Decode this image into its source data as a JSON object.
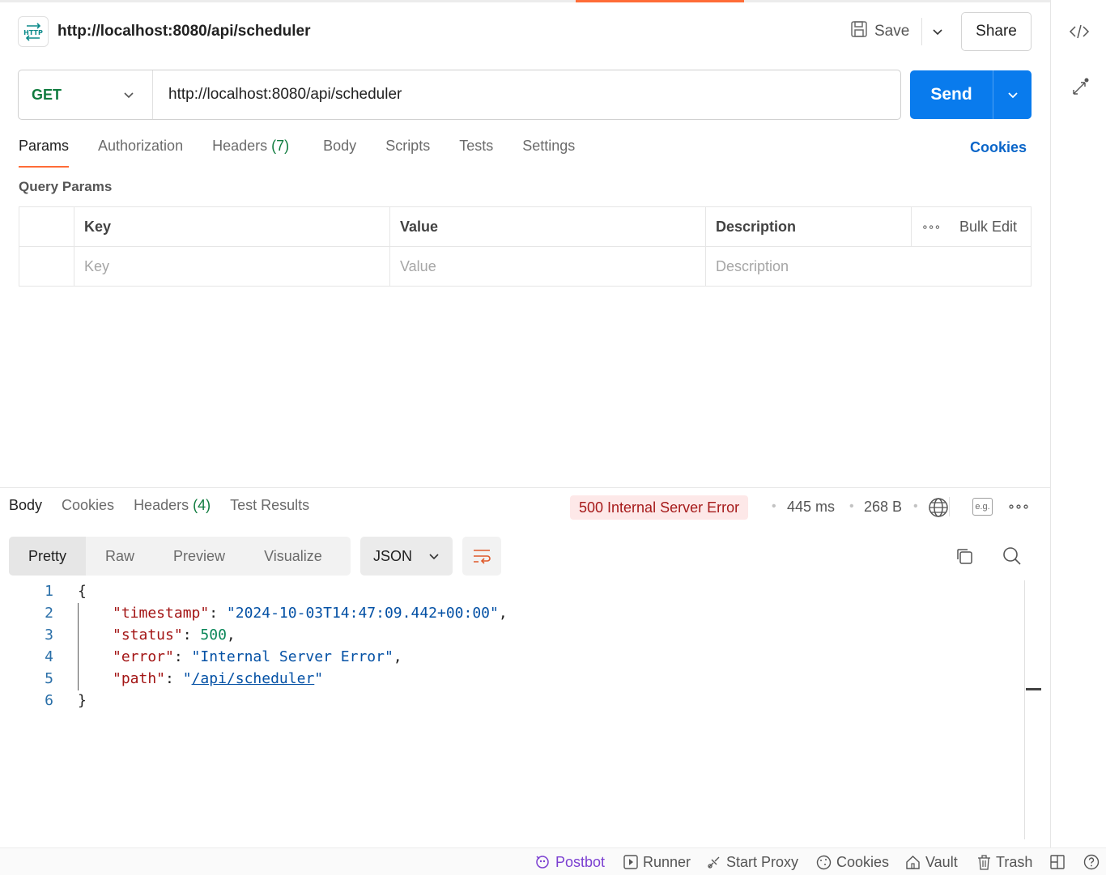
{
  "request": {
    "title": "http://localhost:8080/api/scheduler",
    "method": "GET",
    "url": "http://localhost:8080/api/scheduler",
    "save_label": "Save",
    "share_label": "Share",
    "send_label": "Send"
  },
  "request_tabs": [
    {
      "label": "Params",
      "count": ""
    },
    {
      "label": "Authorization",
      "count": ""
    },
    {
      "label": "Headers",
      "count": "(7)"
    },
    {
      "label": "Body",
      "count": ""
    },
    {
      "label": "Scripts",
      "count": ""
    },
    {
      "label": "Tests",
      "count": ""
    },
    {
      "label": "Settings",
      "count": ""
    }
  ],
  "cookies_link": "Cookies",
  "query_params": {
    "label": "Query Params",
    "headers": {
      "key": "Key",
      "value": "Value",
      "description": "Description",
      "bulk_edit": "Bulk Edit"
    },
    "placeholders": {
      "key": "Key",
      "value": "Value",
      "description": "Description"
    }
  },
  "response": {
    "tabs": [
      {
        "label": "Body",
        "count": ""
      },
      {
        "label": "Cookies",
        "count": ""
      },
      {
        "label": "Headers",
        "count": "(4)"
      },
      {
        "label": "Test Results",
        "count": ""
      }
    ],
    "status": "500 Internal Server Error",
    "time": "445 ms",
    "size": "268 B",
    "views": [
      "Pretty",
      "Raw",
      "Preview",
      "Visualize"
    ],
    "format": "JSON",
    "example_badge": "e.g.",
    "lines": [
      {
        "n": "1",
        "open": "{"
      },
      {
        "n": "2",
        "key": "\"timestamp\"",
        "sep": ": ",
        "val": "\"2024-10-03T14:47:09.442+00:00\"",
        "end": ","
      },
      {
        "n": "3",
        "key": "\"status\"",
        "sep": ": ",
        "num": "500",
        "end": ","
      },
      {
        "n": "4",
        "key": "\"error\"",
        "sep": ": ",
        "val": "\"Internal Server Error\"",
        "end": ","
      },
      {
        "n": "5",
        "key": "\"path\"",
        "sep": ": ",
        "q1": "\"",
        "link": "/api/scheduler",
        "q2": "\""
      },
      {
        "n": "6",
        "close": "}"
      }
    ]
  },
  "statusbar": {
    "postbot": "Postbot",
    "runner": "Runner",
    "start_proxy": "Start Proxy",
    "cookies": "Cookies",
    "vault": "Vault",
    "trash": "Trash"
  },
  "colors": {
    "accent": "#ff6c37",
    "send": "#097bed",
    "get": "#0f7b3e",
    "error_bg": "#fde8e8",
    "error_text": "#a61a1a"
  }
}
